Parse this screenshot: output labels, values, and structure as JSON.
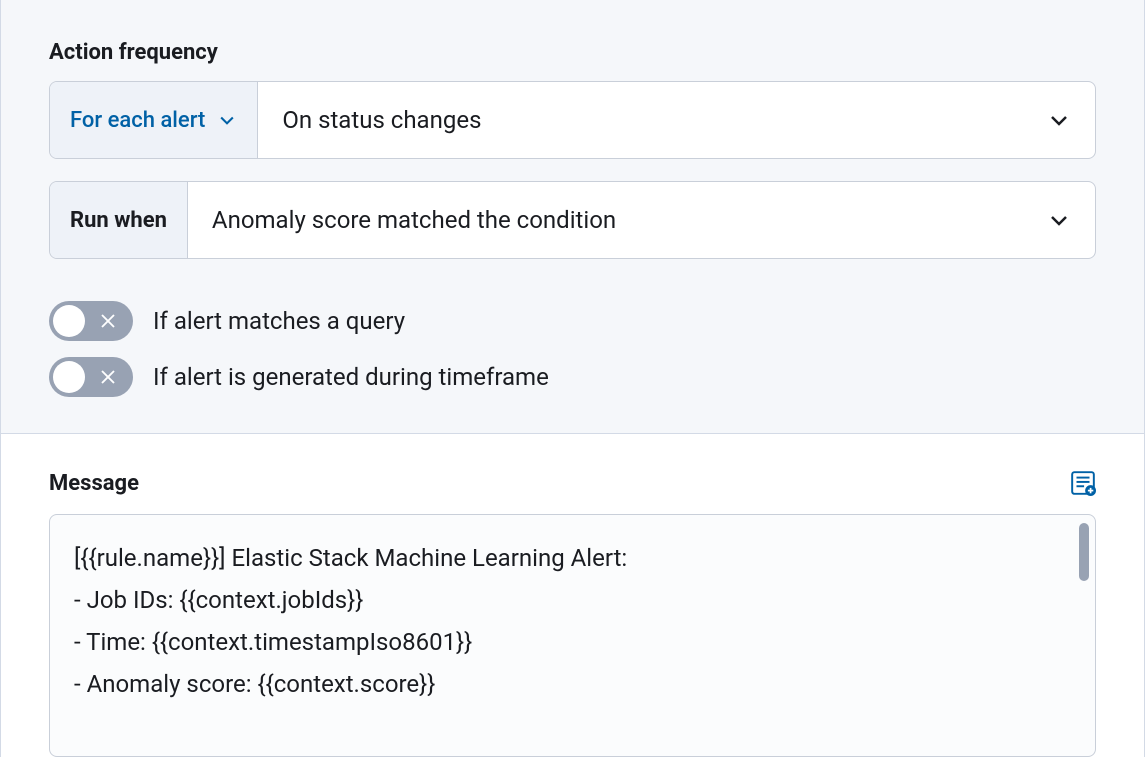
{
  "actionFrequency": {
    "heading": "Action frequency",
    "scope": {
      "label": "For each alert"
    },
    "trigger": {
      "value": "On status changes"
    },
    "runWhen": {
      "label": "Run when",
      "value": "Anomaly score matched the condition"
    }
  },
  "toggles": {
    "matchesQuery": {
      "label": "If alert matches a query",
      "on": false
    },
    "duringTimeframe": {
      "label": "If alert is generated during timeframe",
      "on": false
    }
  },
  "message": {
    "heading": "Message",
    "body": "[{{rule.name}}] Elastic Stack Machine Learning Alert:\n- Job IDs: {{context.jobIds}}\n- Time: {{context.timestampIso8601}}\n- Anomaly score: {{context.score}}"
  }
}
